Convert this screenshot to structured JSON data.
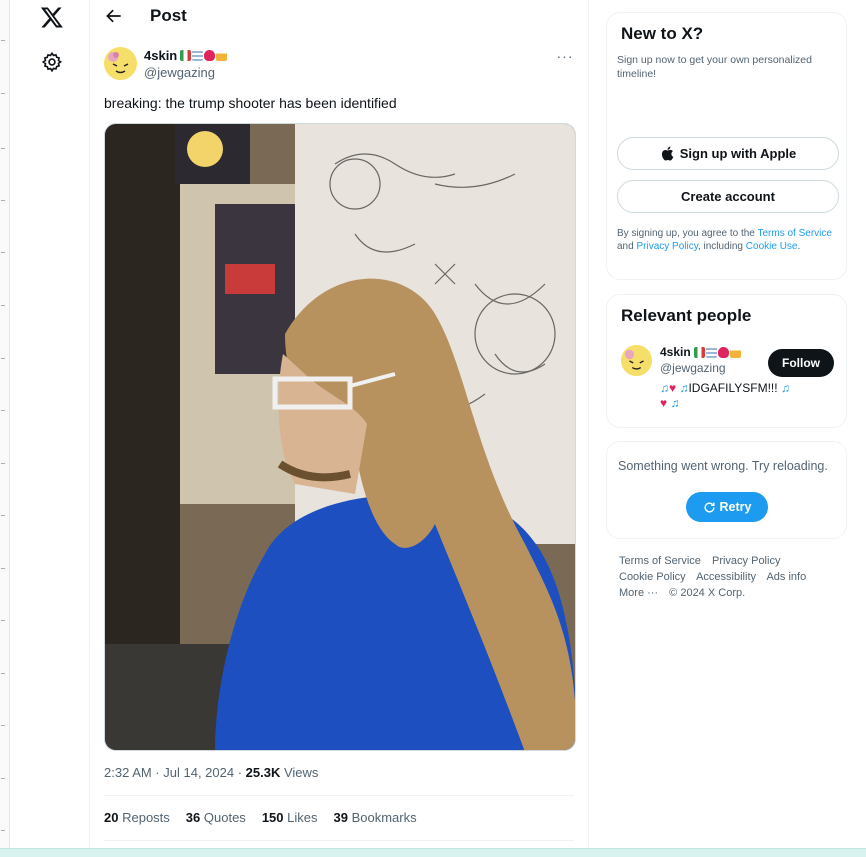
{
  "nav": {
    "logo_icon": "x-logo-icon",
    "settings_icon": "gear-icon"
  },
  "header": {
    "back_icon": "arrow-left-icon",
    "title": "Post"
  },
  "post": {
    "author_name": "4skin",
    "author_handle": "@jewgazing",
    "name_emojis": [
      "flag-emoji",
      "dna-emoji",
      "broken-heart-emoji",
      "beer-emoji"
    ],
    "text": "breaking: the trump shooter has been identified",
    "time": "2:32 AM · Jul 14, 2024 · ",
    "views_count": "25.3K",
    "views_label": " Views",
    "stats": [
      {
        "count": "20",
        "label": "Reposts"
      },
      {
        "count": "36",
        "label": "Quotes"
      },
      {
        "count": "150",
        "label": "Likes"
      },
      {
        "count": "39",
        "label": "Bookmarks"
      }
    ],
    "more_label": "···"
  },
  "sidebar": {
    "new_to_x": {
      "title": "New to X?",
      "subtitle": "Sign up now to get your own personalized timeline!",
      "apple_button": "Sign up with Apple",
      "create_button": "Create account",
      "terms_prefix": "By signing up, you agree to the ",
      "terms_link": "Terms of Service",
      "terms_and": " and ",
      "privacy_link": "Privacy Policy",
      "terms_including": ", including ",
      "cookie_link": "Cookie Use",
      "terms_end": "."
    },
    "relevant_people": {
      "title": "Relevant people",
      "name": "4skin",
      "handle": "@jewgazing",
      "follow_label": "Follow",
      "bio_text": "IDGAFILYSFM!!!"
    },
    "error": {
      "message": "Something went wrong. Try reloading.",
      "retry_label": "Retry"
    },
    "footer": {
      "links": [
        "Terms of Service",
        "Privacy Policy",
        "Cookie Policy",
        "Accessibility",
        "Ads info",
        "More ···"
      ],
      "copyright": "© 2024 X Corp."
    }
  },
  "colors": {
    "accent": "#1d9bf0",
    "text": "#0f1419",
    "muted": "#536471"
  }
}
